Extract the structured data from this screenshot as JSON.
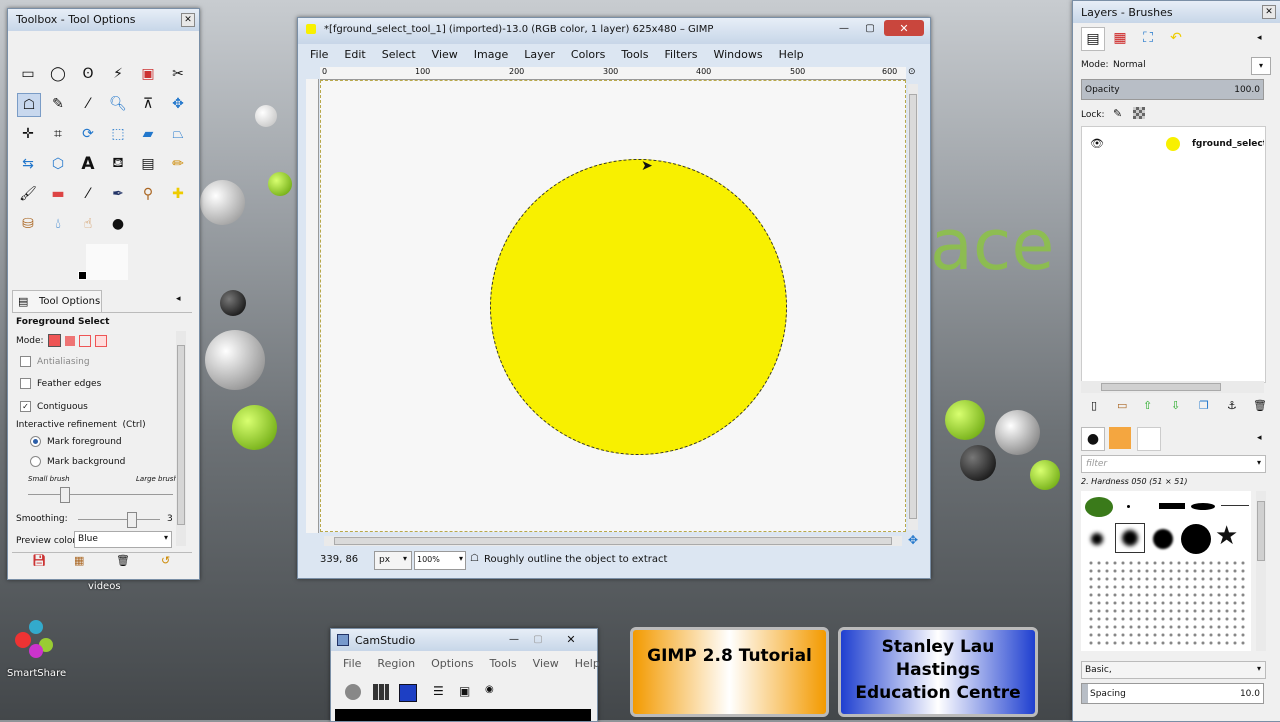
{
  "toolbox": {
    "title": "Toolbox - Tool Options",
    "tab_label": "Tool Options",
    "tool_name": "Foreground Select",
    "mode_label": "Mode:",
    "antialiasing": "Antialiasing",
    "feather_edges": "Feather edges",
    "contiguous": "Contiguous",
    "interactive_refinement": "Interactive refinement  (Ctrl)",
    "mark_foreground": "Mark foreground",
    "mark_background": "Mark background",
    "small_brush": "Small brush",
    "large_brush": "Large brush",
    "smoothing_label": "Smoothing:",
    "smoothing_value": "3",
    "smoothing_level": 0.65,
    "brush_level": 0.25,
    "preview_color_label": "Preview color:",
    "preview_color_value": "Blue"
  },
  "desktop": {
    "videos_label": "videos",
    "smartshare_label": "SmartShare"
  },
  "gimp": {
    "title": "*[fground_select_tool_1] (imported)-13.0 (RGB color, 1 layer) 625x480 – GIMP",
    "menu": [
      "File",
      "Edit",
      "Select",
      "View",
      "Image",
      "Layer",
      "Colors",
      "Tools",
      "Filters",
      "Windows",
      "Help"
    ],
    "ruler_ticks": [
      "0",
      "100",
      "200",
      "300",
      "400",
      "500",
      "600"
    ],
    "coords": "339, 86",
    "unit": "px",
    "zoom": "100%",
    "status": "Roughly outline the object to extract",
    "circle_color": "#f8f000"
  },
  "layers": {
    "title": "Layers - Brushes",
    "mode_label": "Mode:",
    "mode_value": "Normal",
    "opacity_label": "Opacity",
    "opacity_value": "100.0",
    "lock_label": "Lock:",
    "layer_name": "fground_select_tool",
    "filter_placeholder": "filter",
    "brush_name": "2. Hardness 050 (51 × 51)",
    "preset": "Basic,",
    "spacing_label": "Spacing",
    "spacing_value": "10.0"
  },
  "camstudio": {
    "title": "CamStudio",
    "menu": [
      "File",
      "Region",
      "Options",
      "Tools",
      "View",
      "Help"
    ]
  },
  "overlay": {
    "tutorial": "GIMP 2.8 Tutorial",
    "author_line1": "Stanley Lau",
    "author_line2": "Hastings",
    "author_line3": "Education Centre"
  }
}
